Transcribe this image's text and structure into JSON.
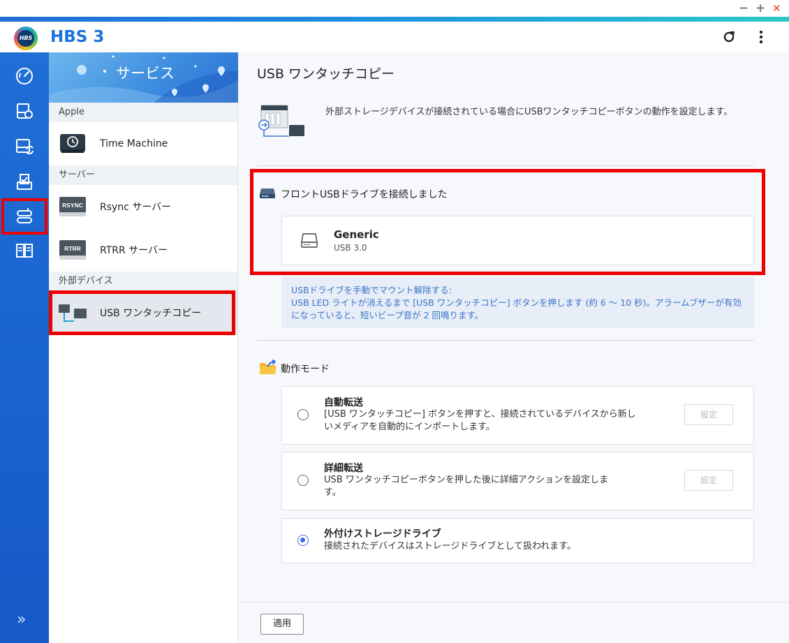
{
  "window": {
    "minimize": "−",
    "maximize": "+",
    "close": "✕"
  },
  "app": {
    "logo_text": "HBS",
    "title": "HBS 3"
  },
  "left_nav": {
    "items": [
      "overview-icon",
      "backup-icon",
      "sync-icon",
      "restore-icon",
      "services-icon",
      "logs-icon"
    ],
    "selected_index": 4,
    "collapse": "»"
  },
  "services_panel": {
    "banner_title": "サービス",
    "sections": [
      {
        "header": "Apple",
        "items": [
          {
            "label": "Time Machine",
            "icon": "time-machine-icon"
          }
        ]
      },
      {
        "header": "サーバー",
        "items": [
          {
            "label": "Rsync サーバー",
            "icon": "rsync-icon",
            "icon_text": "RSYNC"
          },
          {
            "label": "RTRR サーバー",
            "icon": "rtrr-icon",
            "icon_text": "RTRR"
          }
        ]
      },
      {
        "header": "外部デバイス",
        "items": [
          {
            "label": "USB ワンタッチコピー",
            "icon": "usb-copy-icon",
            "selected": true
          }
        ]
      }
    ]
  },
  "main": {
    "title": "USB ワンタッチコピー",
    "description": "外部ストレージデバイスが接続されている場合にUSBワンタッチコピーボタンの動作を設定します。",
    "front_usb_label": "フロントUSBドライブを接続しました",
    "device": {
      "name": "Generic",
      "sub": "USB 3.0"
    },
    "info_lines": [
      "USBドライブを手動でマウント解除する:",
      "USB LED ライトが消えるまで [USB ワンタッチコピー] ボタンを押します (約 6 ～ 10 秒)。アラームブザーが有効",
      "になっていると、短いビープ音が 2 回鳴ります。"
    ],
    "mode_label": "動作モード",
    "options": [
      {
        "title": "自動転送",
        "desc": "[USB ワンタッチコピー] ボタンを押すと、接続されているデバイスから新しいメディアを自動的にインポートします。",
        "button": "設定",
        "selected": false
      },
      {
        "title": "詳細転送",
        "desc": "USB ワンタッチコピーボタンを押した後に詳細アクションを設定します。",
        "button": "設定",
        "selected": false
      },
      {
        "title": "外付けストレージドライブ",
        "desc": "接続されたデバイスはストレージドライブとして扱われます。",
        "selected": true
      }
    ],
    "apply_label": "適用"
  },
  "colors": {
    "accent": "#1a73d9",
    "highlight": "#e00000",
    "radio_on": "#3a6fe0",
    "info_text": "#3b73c9"
  }
}
